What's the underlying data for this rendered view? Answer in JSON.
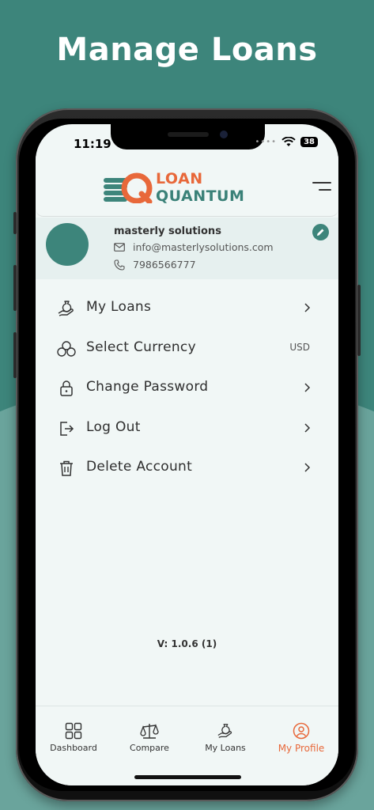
{
  "promo": {
    "headline": "Manage Loans"
  },
  "status_bar": {
    "time": "11:19",
    "battery": "38"
  },
  "header": {
    "logo_line1": "LOAN",
    "logo_line2": "QUANTUM"
  },
  "profile": {
    "name": "masterly solutions",
    "email": "info@masterlysolutions.com",
    "phone": "7986566777"
  },
  "menu": {
    "items": [
      {
        "label": "My Loans",
        "icon": "hand-money-icon"
      },
      {
        "label": "Select Currency",
        "icon": "coins-icon",
        "value": "USD"
      },
      {
        "label": "Change Password",
        "icon": "lock-icon"
      },
      {
        "label": "Log Out",
        "icon": "logout-icon"
      },
      {
        "label": "Delete Account",
        "icon": "trash-icon"
      }
    ]
  },
  "version": "V: 1.0.6 (1)",
  "tabs": [
    {
      "label": "Dashboard",
      "icon": "grid-icon"
    },
    {
      "label": "Compare",
      "icon": "scale-icon"
    },
    {
      "label": "My Loans",
      "icon": "hand-money-icon"
    },
    {
      "label": "My Profile",
      "icon": "user-circle-icon",
      "active": true
    }
  ],
  "colors": {
    "brand_teal": "#3d857b",
    "brand_orange": "#e8683a",
    "screen_bg": "#f1f7f6"
  }
}
